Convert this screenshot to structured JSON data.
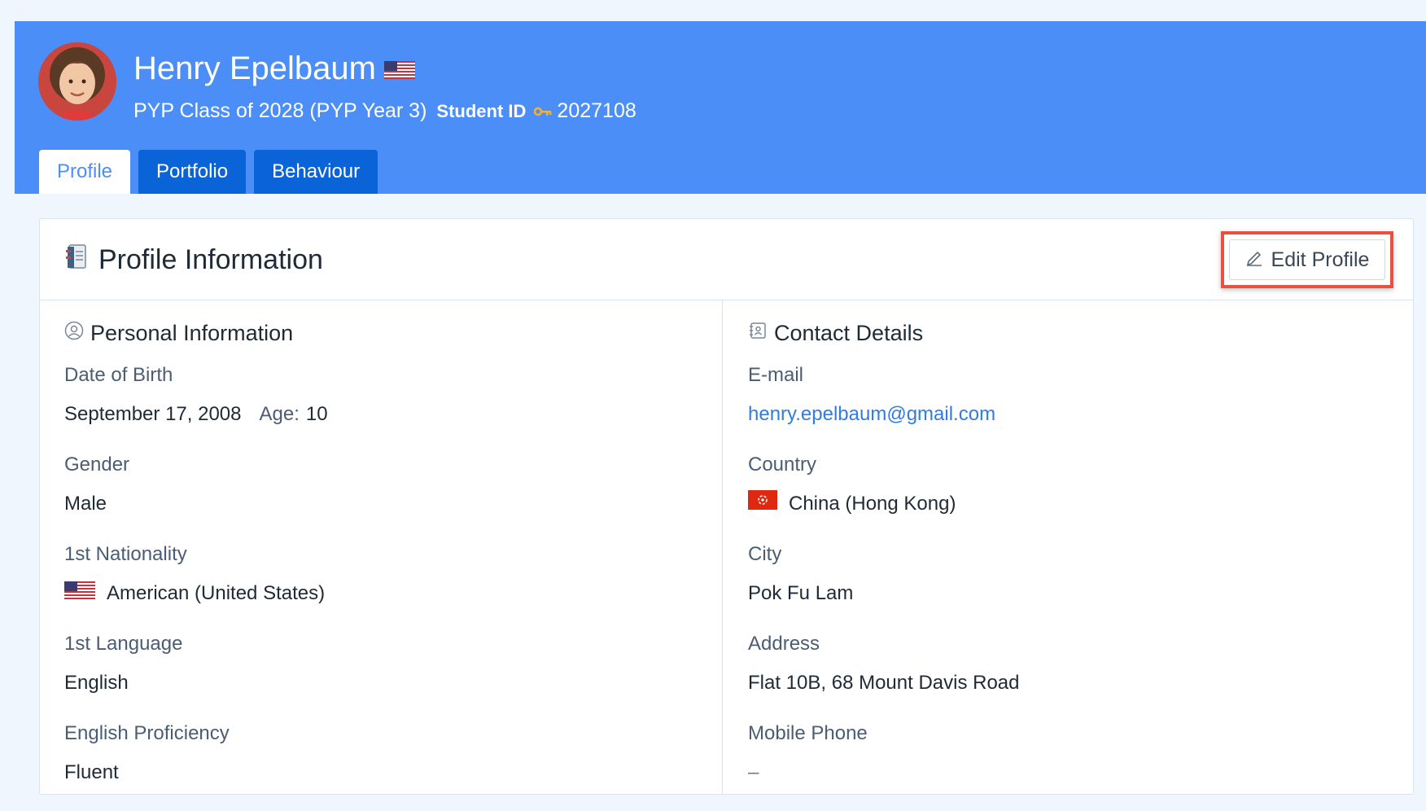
{
  "student": {
    "name": "Henry Epelbaum",
    "class_line": "PYP Class of 2028 (PYP Year 3)",
    "student_id_label": "Student ID",
    "student_id": "2027108",
    "avatar_icon": "student-photo",
    "nationality_flag_icon": "us-flag-icon"
  },
  "tabs": [
    {
      "label": "Profile",
      "active": true
    },
    {
      "label": "Portfolio",
      "active": false
    },
    {
      "label": "Behaviour",
      "active": false
    }
  ],
  "card": {
    "title": "Profile Information",
    "title_icon": "notebook-icon",
    "edit_button": "Edit Profile",
    "edit_icon": "pencil-icon",
    "highlight_color": "#e8503f"
  },
  "personal": {
    "title": "Personal Information",
    "icon": "user-circle-icon",
    "fields": {
      "dob": {
        "label": "Date of Birth",
        "value": "September 17, 2008",
        "age_label": "Age:",
        "age": "10"
      },
      "gender": {
        "label": "Gender",
        "value": "Male"
      },
      "nationality": {
        "label": "1st Nationality",
        "value": "American (United States)",
        "flag": "us-flag-icon"
      },
      "language": {
        "label": "1st Language",
        "value": "English"
      },
      "proficiency": {
        "label": "English Proficiency",
        "value": "Fluent"
      }
    }
  },
  "contact": {
    "title": "Contact Details",
    "icon": "contact-card-icon",
    "fields": {
      "email": {
        "label": "E-mail",
        "value": "henry.epelbaum@gmail.com"
      },
      "country": {
        "label": "Country",
        "value": "China (Hong Kong)",
        "flag": "hong-kong-flag-icon"
      },
      "city": {
        "label": "City",
        "value": "Pok Fu Lam"
      },
      "address": {
        "label": "Address",
        "value": "Flat 10B, 68 Mount Davis Road"
      },
      "mobile": {
        "label": "Mobile Phone",
        "value": "–"
      }
    }
  },
  "colors": {
    "header_bg": "#4c8ef7",
    "tab_bg": "#0b63d8",
    "link": "#2f7de1",
    "page_bg": "#f0f6fd"
  }
}
